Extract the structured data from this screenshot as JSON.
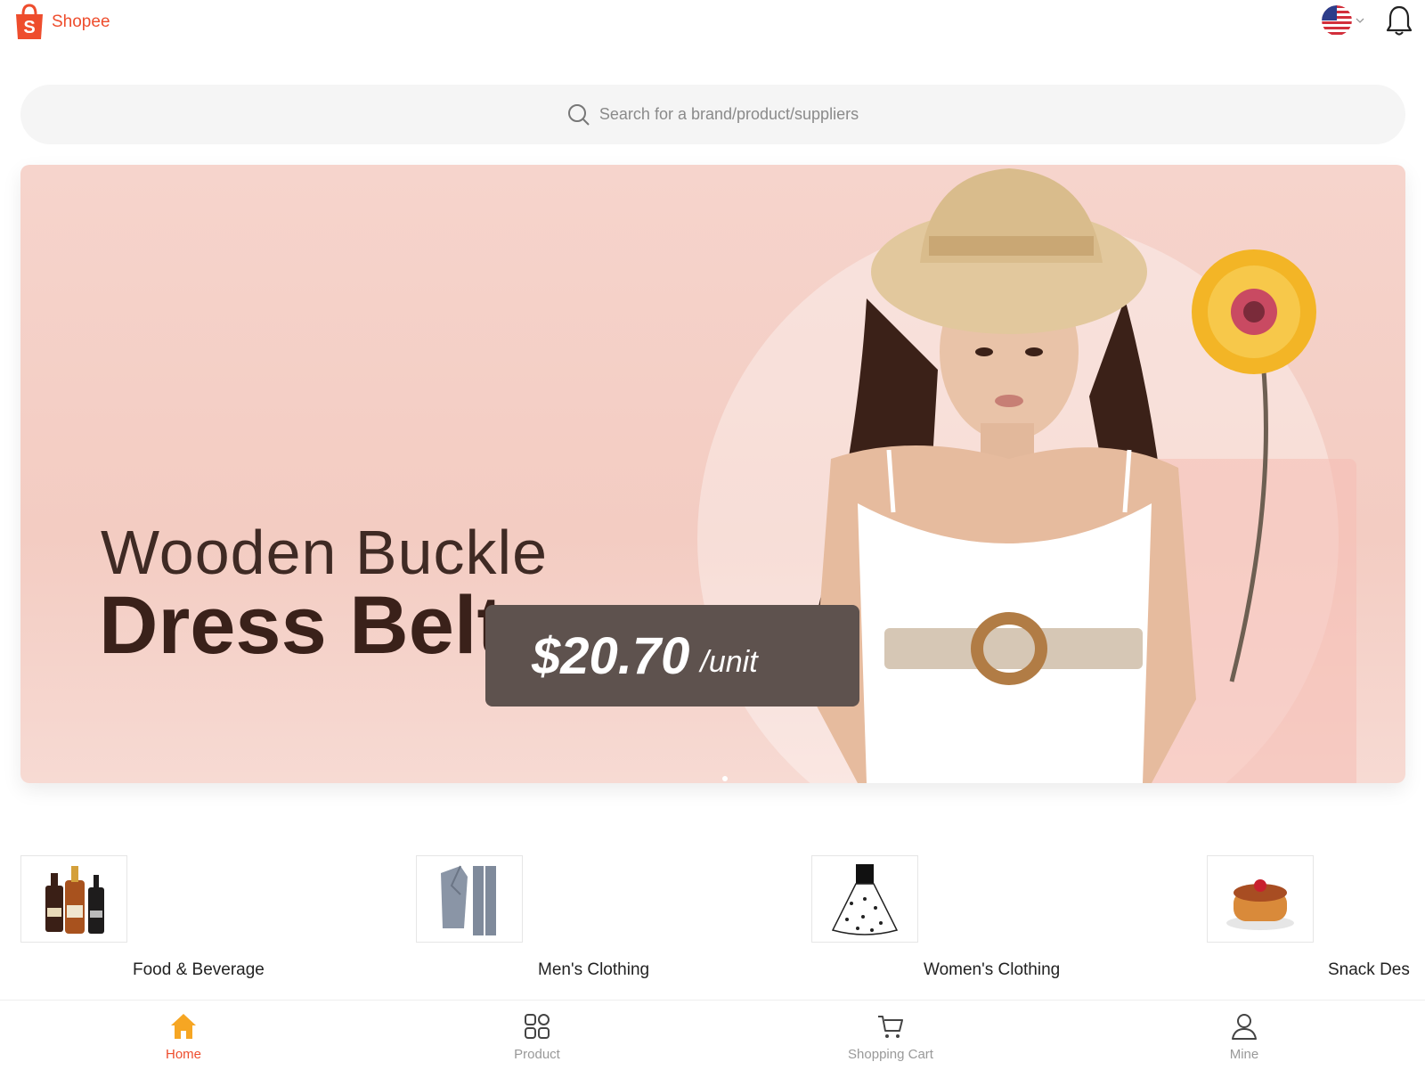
{
  "header": {
    "logo_text": "Shopee",
    "logo_glyph": "S",
    "brand_color": "#ee4d2d"
  },
  "search": {
    "placeholder": "Search for a brand/product/suppliers"
  },
  "banner": {
    "line1": "Wooden Buckle",
    "line2": "Dress Belts",
    "price": "$20.70",
    "unit": "/unit"
  },
  "categories": [
    {
      "label": "Food & Beverage",
      "icon": "liquor-bottles"
    },
    {
      "label": "Men's Clothing",
      "icon": "suit"
    },
    {
      "label": "Women's Clothing",
      "icon": "dress"
    },
    {
      "label": "Snack Des",
      "icon": "pancake"
    }
  ],
  "nav": {
    "items": [
      {
        "label": "Home",
        "icon": "home-icon",
        "active": true
      },
      {
        "label": "Product",
        "icon": "grid-icon",
        "active": false
      },
      {
        "label": "Shopping Cart",
        "icon": "cart-icon",
        "active": false
      },
      {
        "label": "Mine",
        "icon": "user-icon",
        "active": false
      }
    ],
    "active_color": "#ee4d2d",
    "home_icon_color": "#f6a623",
    "inactive_color": "#999999"
  }
}
